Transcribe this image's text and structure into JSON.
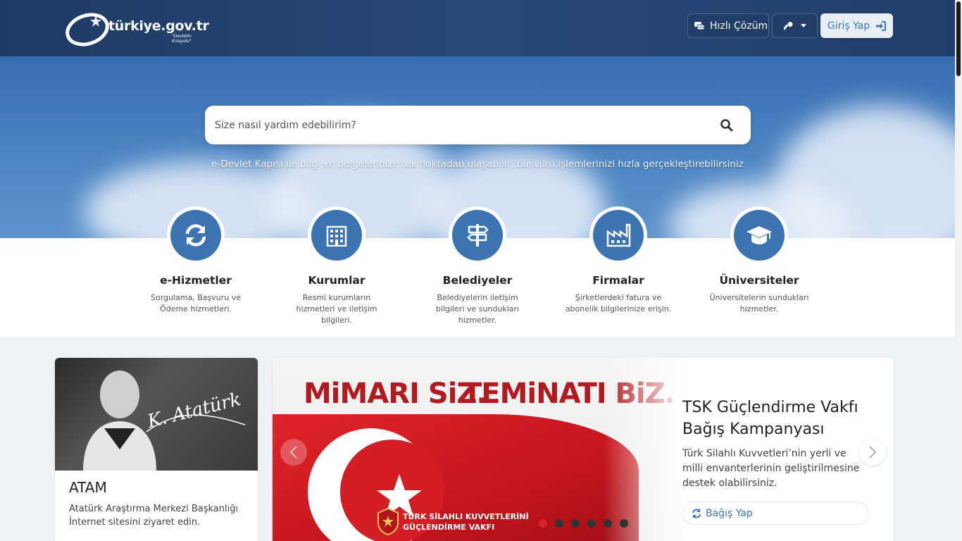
{
  "header": {
    "logo_text": "türkiye.gov.tr",
    "logo_sub": "\"Devletin Kısayolu\"",
    "hizli_cozum_label": "Hızlı Çözüm",
    "giris_label": "Giriş Yap"
  },
  "search": {
    "placeholder": "Size nasıl yardım edebilirim?",
    "tagline": "e-Devlet Kapısı ile bilgi ve belgelerinize tek noktadan ulaşabilir, başvuru işlemlerinizi hızla gerçekleştirebilirsiniz"
  },
  "categories": [
    {
      "title": "e-Hizmetler",
      "desc": "Sorgulama, Başvuru ve Ödeme hizmetleri.",
      "icon": "refresh-icon"
    },
    {
      "title": "Kurumlar",
      "desc": "Resmi kurumların hizmetleri ve iletişim bilgileri.",
      "icon": "building-icon"
    },
    {
      "title": "Belediyeler",
      "desc": "Belediyelerin iletişim bilgileri ve sundukları hizmetler.",
      "icon": "signpost-icon"
    },
    {
      "title": "Firmalar",
      "desc": "Şirketlerdeki fatura ve abonelik bilgilerinize erişin.",
      "icon": "factory-icon"
    },
    {
      "title": "Üniversiteler",
      "desc": "Üniversitelerin sundukları hizmetler.",
      "icon": "graduation-cap-icon"
    }
  ],
  "atam": {
    "title": "ATAM",
    "desc": "Atatürk Araştırma Merkezi Başkanlığı İnternet sitesini ziyaret edin.",
    "signature": "K. Atatürk"
  },
  "slider": {
    "banner_left": "MiMARI SiZ.",
    "banner_right": "TEMiNATI BiZ.",
    "vakif_line1": "TÜRK SİLAHLI KUVVETLERİNİ",
    "vakif_line2": "GÜÇLENDİRME VAKFI",
    "title": "TSK Güçlendirme Vakfı Bağış Kampanyası",
    "desc": "Türk Silahlı Kuvvetleri’nin yerli ve milli envanterlerinin geliştirilmesine destek olabilirsiniz.",
    "button_label": "Bağış Yap",
    "active_slide": 1,
    "slide_count": 6
  },
  "colors": {
    "accent": "#3d73b0",
    "topbar": "#223f6b",
    "active_dot": "#d9232a"
  }
}
